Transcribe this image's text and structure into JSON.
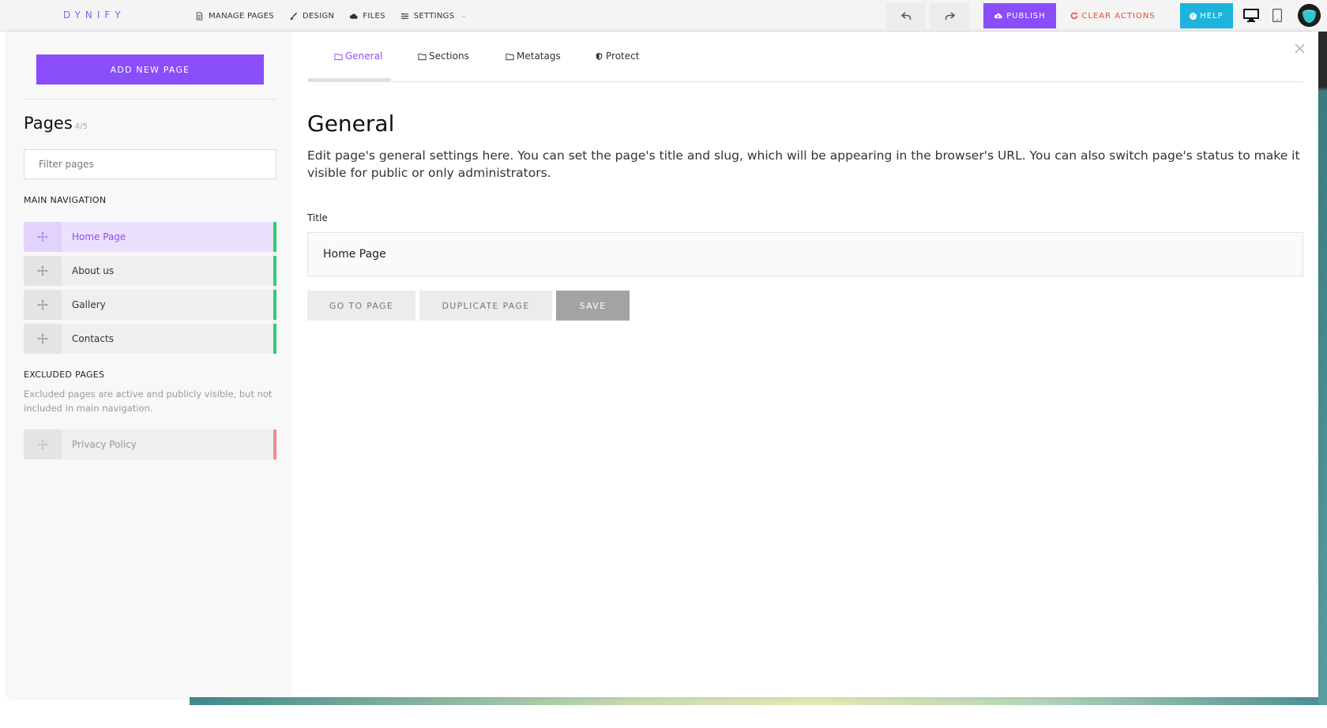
{
  "topbar": {
    "logo": "DYNIFY",
    "nav": [
      {
        "label": "MANAGE PAGES",
        "icon": "document-icon"
      },
      {
        "label": "DESIGN",
        "icon": "brush-icon"
      },
      {
        "label": "FILES",
        "icon": "cloud-icon"
      },
      {
        "label": "SETTINGS",
        "icon": "sliders-icon"
      }
    ],
    "publish_label": "PUBLISH",
    "clear_label": "CLEAR ACTIONS",
    "help_label": "HELP",
    "colors": {
      "accent": "#8a4dfa",
      "danger": "#e8453c",
      "help": "#1eb3dc"
    }
  },
  "sidebar": {
    "add_button": "ADD NEW PAGE",
    "title": "Pages",
    "count": "4/5",
    "filter_placeholder": "Filter pages",
    "main_nav_label": "MAIN NAVIGATION",
    "main_pages": [
      "Home Page",
      "About us",
      "Gallery",
      "Contacts"
    ],
    "excluded_label": "EXCLUDED PAGES",
    "excluded_desc": "Excluded pages are active and publicly visible, but not included in main navigation.",
    "excluded_pages": [
      "Privacy Policy"
    ]
  },
  "tabs": [
    {
      "label": "General",
      "icon": "folder-icon",
      "active": true
    },
    {
      "label": "Sections",
      "icon": "folder-icon",
      "active": false
    },
    {
      "label": "Metatags",
      "icon": "folder-icon",
      "active": false
    },
    {
      "label": "Protect",
      "icon": "shield-icon",
      "active": false
    }
  ],
  "main": {
    "title": "General",
    "description": "Edit page's general settings here. You can set the page's title and slug, which will be appearing in the browser's URL. You can also switch page's status to make it visible for public or only administrators.",
    "field_label": "Title",
    "title_value": "Home Page",
    "go_label": "GO TO PAGE",
    "duplicate_label": "DUPLICATE PAGE",
    "save_label": "SAVE"
  }
}
